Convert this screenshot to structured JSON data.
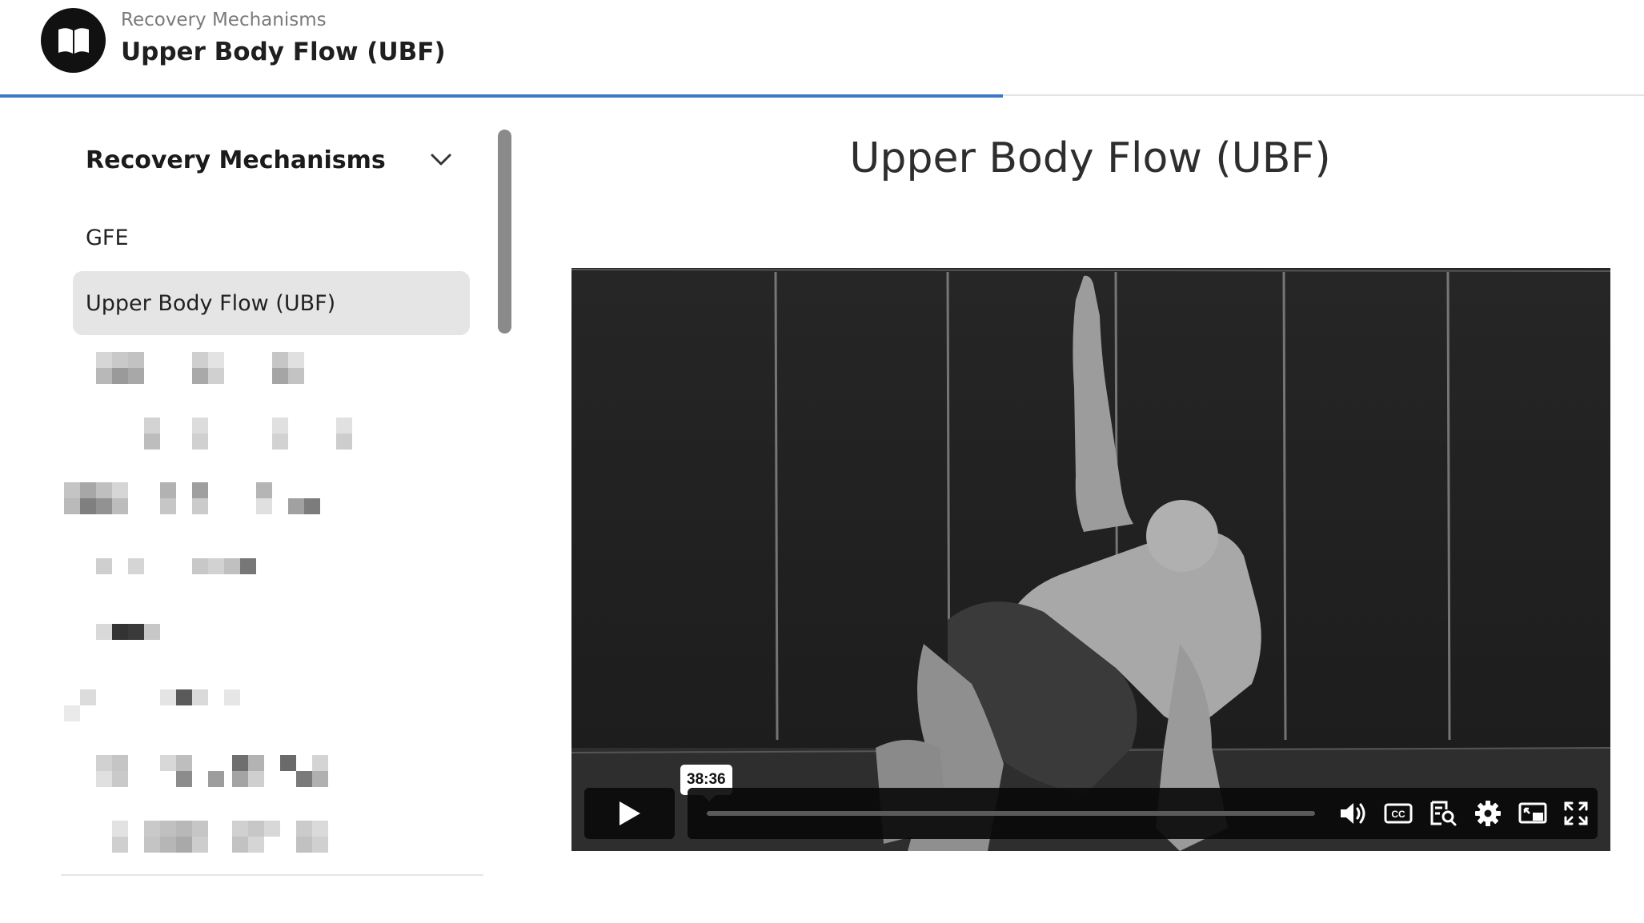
{
  "header": {
    "breadcrumb": "Recovery Mechanisms",
    "title": "Upper Body Flow (UBF)",
    "logo_icon": "open-book-icon",
    "progress_percent": 61
  },
  "sidebar": {
    "section_title": "Recovery Mechanisms",
    "section_icon": "chevron-down-icon",
    "items": [
      {
        "label": "GFE",
        "active": false
      },
      {
        "label": "Upper Body Flow (UBF)",
        "active": true
      }
    ],
    "redacted_item_count": 8
  },
  "main": {
    "title": "Upper Body Flow (UBF)"
  },
  "video": {
    "hover_time": "38:36",
    "controls": [
      "play-icon",
      "volume-icon",
      "cc-icon",
      "transcript-search-icon",
      "settings-gear-icon",
      "picture-in-picture-icon",
      "fullscreen-icon"
    ]
  },
  "colors": {
    "accent": "#3a78c4",
    "active_item_bg": "#e5e5e5"
  }
}
